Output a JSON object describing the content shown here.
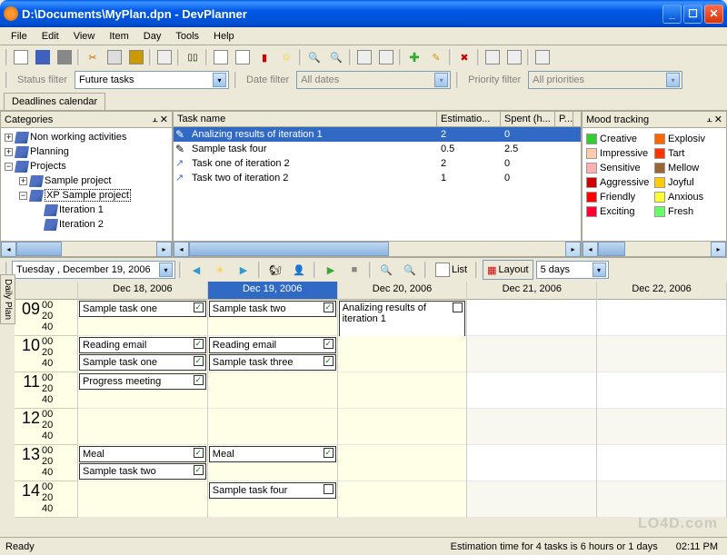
{
  "window": {
    "title": "D:\\Documents\\MyPlan.dpn - DevPlanner"
  },
  "menu": [
    "File",
    "Edit",
    "View",
    "Item",
    "Day",
    "Tools",
    "Help"
  ],
  "filters": {
    "status_label": "Status filter",
    "status_value": "Future tasks",
    "date_label": "Date filter",
    "date_value": "All dates",
    "priority_label": "Priority filter",
    "priority_value": "All priorities"
  },
  "tabs": {
    "deadlines": "Deadlines calendar"
  },
  "categories": {
    "title": "Categories",
    "items": [
      {
        "label": "Non working activities",
        "expand": "+",
        "indent": 0
      },
      {
        "label": "Planning",
        "expand": "+",
        "indent": 0
      },
      {
        "label": "Projects",
        "expand": "−",
        "indent": 0
      },
      {
        "label": "Sample project",
        "expand": "+",
        "indent": 1
      },
      {
        "label": "XP Sample project",
        "expand": "−",
        "indent": 1,
        "selected": true
      },
      {
        "label": "Iteration 1",
        "expand": "",
        "indent": 2
      },
      {
        "label": "Iteration 2",
        "expand": "",
        "indent": 2
      }
    ]
  },
  "tasks": {
    "title": "Task name",
    "cols": {
      "name": "Task name",
      "est": "Estimatio...",
      "spent": "Spent (h...",
      "p": "P..."
    },
    "rows": [
      {
        "name": "Analizing results of iteration 1",
        "est": "2",
        "spent": "0",
        "selected": true,
        "icon": "pencil"
      },
      {
        "name": "Sample task four",
        "est": "0.5",
        "spent": "2.5",
        "icon": "pencil"
      },
      {
        "name": "Task one of iteration 2",
        "est": "2",
        "spent": "0",
        "icon": "arrow"
      },
      {
        "name": "Task two of iteration 2",
        "est": "1",
        "spent": "0",
        "icon": "arrow"
      }
    ]
  },
  "mood": {
    "title": "Mood tracking",
    "items": [
      {
        "name": "Creative",
        "color": "#33cc33"
      },
      {
        "name": "Explosiv",
        "color": "#ff6600"
      },
      {
        "name": "Impressive",
        "color": "#ffccaa"
      },
      {
        "name": "Tart",
        "color": "#ff3300"
      },
      {
        "name": "Sensitive",
        "color": "#ffb0b0"
      },
      {
        "name": "Mellow",
        "color": "#996633"
      },
      {
        "name": "Aggressive",
        "color": "#cc0000"
      },
      {
        "name": "Joyful",
        "color": "#ffcc00"
      },
      {
        "name": "Friendly",
        "color": "#ff0000"
      },
      {
        "name": "Anxious",
        "color": "#ffff33"
      },
      {
        "name": "Exciting",
        "color": "#ff0033"
      },
      {
        "name": "Fresh",
        "color": "#66ff66"
      }
    ]
  },
  "calendar": {
    "date_display": "Tuesday  , December 19, 2006",
    "list_btn": "List",
    "layout_btn": "Layout",
    "range_value": "5 days",
    "daily_plan_tab": "Daily Plan",
    "hours": [
      "09",
      "10",
      "11",
      "12",
      "13",
      "14"
    ],
    "mins": [
      "00",
      "20",
      "40"
    ],
    "days": [
      {
        "label": "Dec 18, 2006",
        "today": false,
        "events": [
          {
            "h": 0,
            "text": "Sample task one",
            "checked": true
          },
          {
            "h": 1,
            "text": "Reading email",
            "checked": true
          },
          {
            "h": 1,
            "text": "Sample task one",
            "checked": true
          },
          {
            "h": 2,
            "text": "Progress meeting",
            "checked": true
          },
          {
            "h": 4,
            "text": "Meal",
            "checked": true
          },
          {
            "h": 4,
            "text": "Sample task two",
            "checked": true
          }
        ]
      },
      {
        "label": "Dec 19, 2006",
        "today": true,
        "events": [
          {
            "h": 0,
            "text": "Sample task two",
            "checked": true
          },
          {
            "h": 1,
            "text": "Reading email",
            "checked": true
          },
          {
            "h": 1,
            "text": "Sample task three",
            "checked": true
          },
          {
            "h": 4,
            "text": "Meal",
            "checked": true
          },
          {
            "h": 5,
            "text": "Sample task four",
            "checked": false
          }
        ]
      },
      {
        "label": "Dec 20, 2006",
        "today": false,
        "events": [
          {
            "h": 0,
            "text": "Analizing results of iteration 1",
            "checked": false,
            "tall": true
          }
        ]
      },
      {
        "label": "Dec 21, 2006",
        "today": false,
        "events": []
      },
      {
        "label": "Dec 22, 2006",
        "today": false,
        "events": []
      }
    ]
  },
  "status": {
    "ready": "Ready",
    "estimation": "Estimation time for 4 tasks is 6 hours or 1 days",
    "time": "02:11 PM"
  },
  "watermark": "LO4D.com"
}
